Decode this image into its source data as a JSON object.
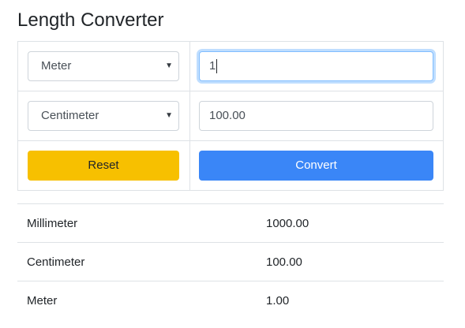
{
  "title": "Length Converter",
  "from": {
    "unit": "Meter",
    "value": "1"
  },
  "to": {
    "unit": "Centimeter",
    "value": "100.00"
  },
  "buttons": {
    "reset": "Reset",
    "convert": "Convert"
  },
  "results": [
    {
      "unit": "Millimeter",
      "value": "1000.00"
    },
    {
      "unit": "Centimeter",
      "value": "100.00"
    },
    {
      "unit": "Meter",
      "value": "1.00"
    }
  ],
  "icons": {
    "select_caret": "caret-down-icon"
  },
  "colors": {
    "reset_button": "#f7c000",
    "convert_button": "#3a86f7",
    "focus_border": "#80bdff"
  }
}
